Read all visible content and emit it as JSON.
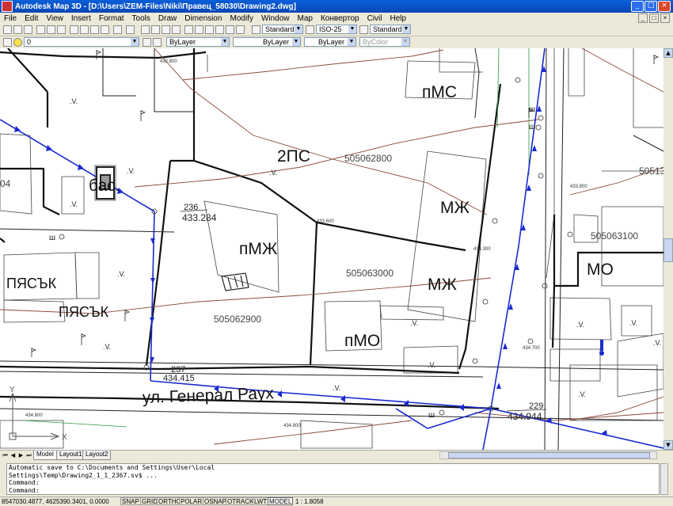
{
  "window": {
    "title": "Autodesk Map 3D - [D:\\Users\\ZEM-Files\\Niki\\Правец_58030\\Drawing2.dwg]",
    "controls": [
      "_",
      "□",
      "×"
    ]
  },
  "menu": [
    "File",
    "Edit",
    "View",
    "Insert",
    "Format",
    "Tools",
    "Draw",
    "Dimension",
    "Modify",
    "Window",
    "Map",
    "Конвертор",
    "Civil",
    "Help"
  ],
  "toolbar": {
    "text_style": "Standard",
    "dim_style": "ISO-25",
    "table_style": "Standard",
    "layer": "0",
    "color": "ByLayer",
    "linetype": "ByLayer",
    "lineweight": "ByLayer",
    "plot_style": "ByColor"
  },
  "drawing": {
    "labels": {
      "pms": "пМС",
      "ps2": "2ПС",
      "parcel_1": "505062800",
      "mzh_1": "МЖ",
      "bas": "бас.",
      "point_num": "236",
      "point_elev": "433.284",
      "pmzh": "пМЖ",
      "mzh_2": "МЖ",
      "parcel_2": "505063000",
      "parcel_3": "505062900",
      "pmo": "пМО",
      "pyasak_1": "ПЯСЪК",
      "pyasak_2": "ПЯСЪК",
      "parcel_4": "505063100",
      "mo": "МО",
      "parcel_partial": "50513",
      "num_04": "04",
      "street": "ул. Генерал Раух",
      "pt237": "237",
      "pt237_elev": "434.415",
      "pt229": "229",
      "pt229_elev": "434.944",
      "elev_432800": "432.800",
      "elev_433600": "433.600",
      "elev_433800": "433.800",
      "elev_434300": "434.300",
      "elev_434700": "434.700",
      "elev_434600": "434.600",
      "elev_434800": "434.800",
      "sh_1": "ш",
      "sh_2": "ш",
      "sh_3": "ш",
      "sh_4": "ш",
      "axis_y": "Y",
      "axis_x": "X"
    }
  },
  "tabs": [
    "Model",
    "Layout1",
    "Layout2"
  ],
  "command_lines": [
    "Automatic save to C:\\Documents and Settings\\User\\Local",
    "Settings\\Temp\\Drawing2_1_1_2367.sv$ ...",
    "Command:",
    "Command:"
  ],
  "status": {
    "coordinates": "8547030.4877, 4625390.3401, 0.0000",
    "buttons": [
      "SNAP",
      "GRID",
      "ORTHO",
      "POLAR",
      "OSNAP",
      "OTRACK",
      "LWT",
      "MODEL"
    ],
    "scale": "1 : 1.8058"
  }
}
